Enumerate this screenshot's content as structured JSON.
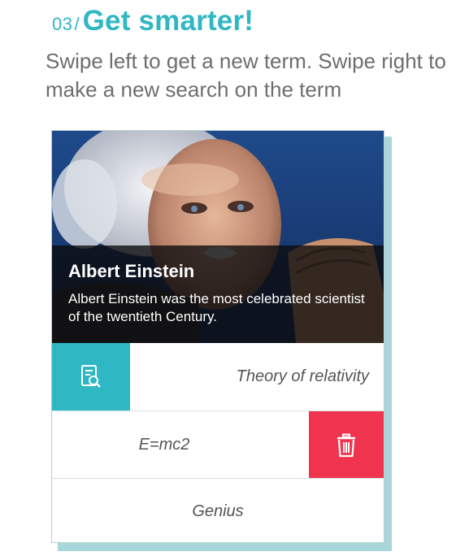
{
  "header": {
    "step_number": "03",
    "separator": "/",
    "title": "Get smarter!",
    "subtitle": "Swipe left to get a new term. Swipe right to make a new search on the term"
  },
  "card": {
    "person_name": "Albert Einstein",
    "description": "Albert Einstein was the most celebrated scientist of the twentieth Century.",
    "terms": [
      {
        "label": "Theory of relativity",
        "action": "search",
        "action_icon": "document-search-icon"
      },
      {
        "label": "E=mc2",
        "action": "delete",
        "action_icon": "trash-icon"
      },
      {
        "label": "Genius"
      }
    ]
  },
  "colors": {
    "accent_teal": "#2fb7c4",
    "delete_red": "#f0344f",
    "text_gray": "#6e6e6e"
  }
}
